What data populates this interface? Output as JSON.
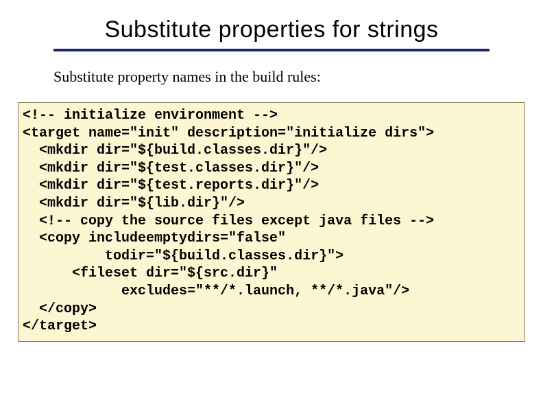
{
  "title": "Substitute properties for strings",
  "subtitle": "Substitute property names in the build rules:",
  "code": "<!-- initialize environment -->\n<target name=\"init\" description=\"initialize dirs\">\n  <mkdir dir=\"${build.classes.dir}\"/>\n  <mkdir dir=\"${test.classes.dir}\"/>\n  <mkdir dir=\"${test.reports.dir}\"/>\n  <mkdir dir=\"${lib.dir}\"/>\n  <!-- copy the source files except java files -->\n  <copy includeemptydirs=\"false\"\n          todir=\"${build.classes.dir}\">\n      <fileset dir=\"${src.dir}\"\n            excludes=\"**/*.launch, **/*.java\"/>\n  </copy>\n</target>"
}
